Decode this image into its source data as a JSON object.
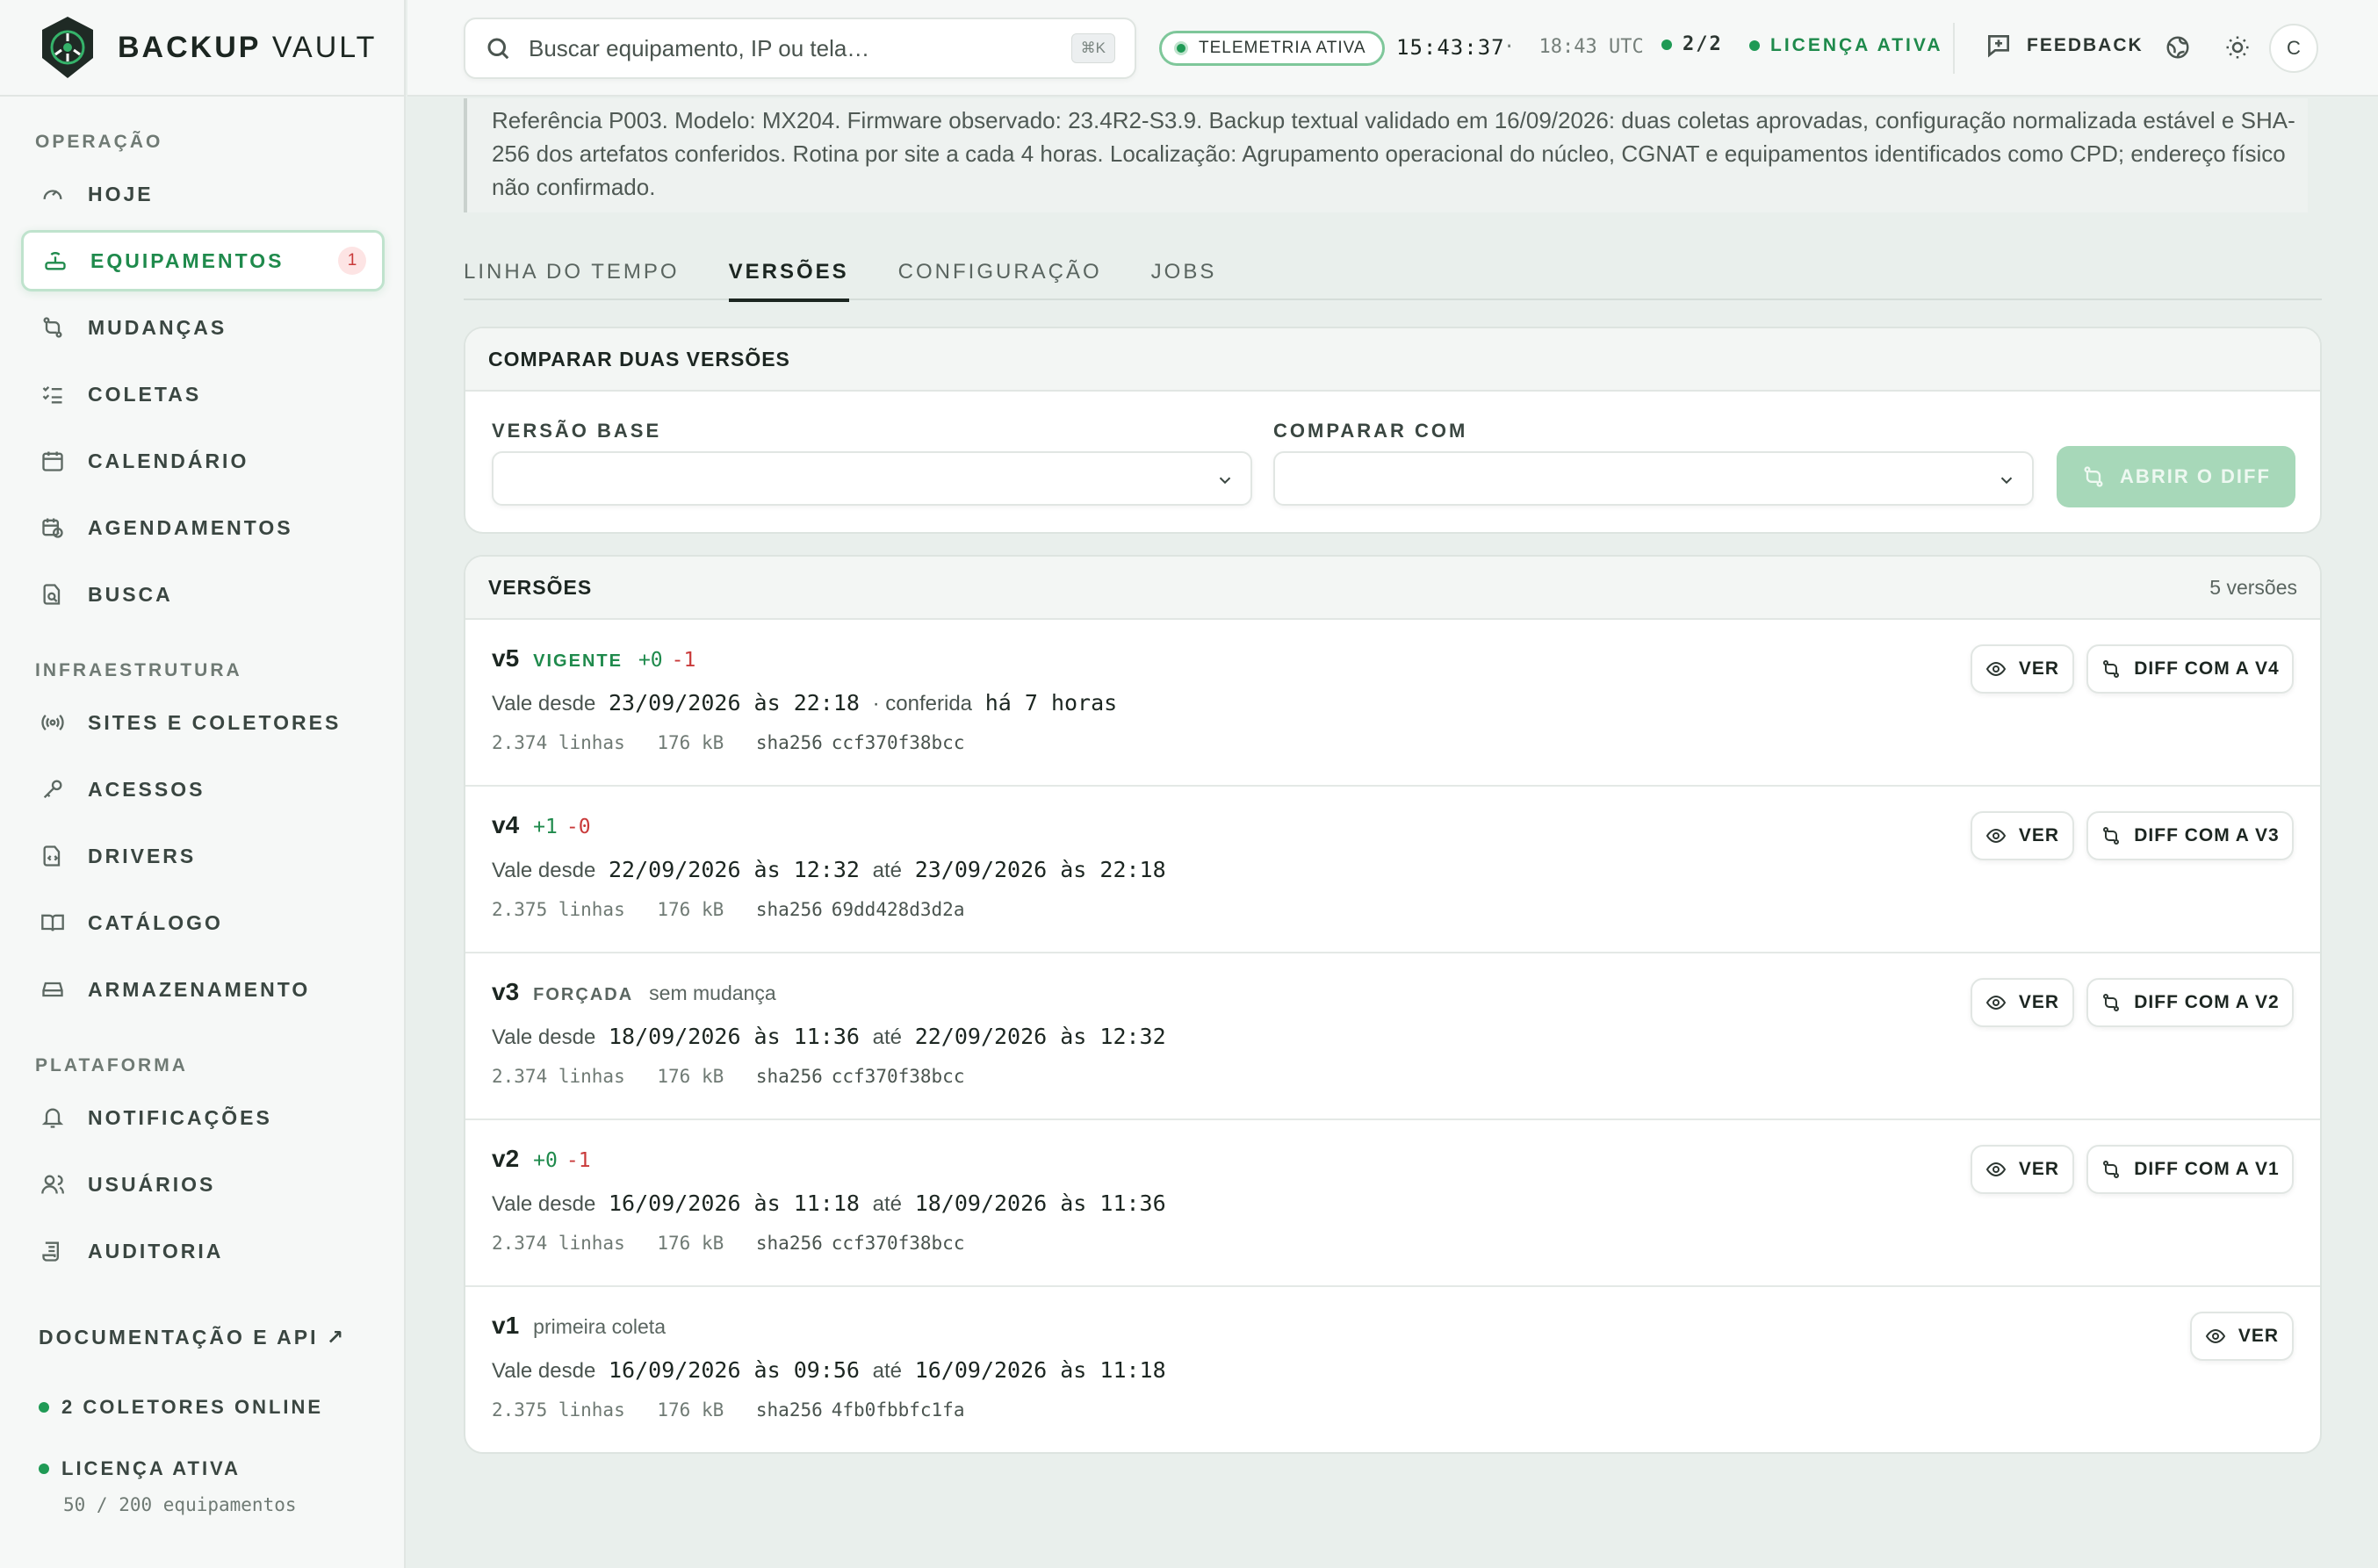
{
  "app": {
    "brand_bold": "BACKUP",
    "brand_light": "VAULT"
  },
  "sidebar": {
    "sections": [
      {
        "title": "OPERAÇÃO"
      },
      {
        "title": "INFRAESTRUTURA"
      },
      {
        "title": "PLATAFORMA"
      }
    ],
    "items": [
      {
        "label": "HOJE",
        "icon": "gauge-icon"
      },
      {
        "label": "EQUIPAMENTOS",
        "icon": "router-icon",
        "badge": "1",
        "active": true
      },
      {
        "label": "MUDANÇAS",
        "icon": "git-compare-icon"
      },
      {
        "label": "COLETAS",
        "icon": "list-checks-icon"
      },
      {
        "label": "CALENDÁRIO",
        "icon": "calendar-icon"
      },
      {
        "label": "AGENDAMENTOS",
        "icon": "calendar-clock-icon"
      },
      {
        "label": "BUSCA",
        "icon": "file-search-icon"
      },
      {
        "label": "SITES E COLETORES",
        "icon": "radio-icon"
      },
      {
        "label": "ACESSOS",
        "icon": "key-icon"
      },
      {
        "label": "DRIVERS",
        "icon": "file-code-icon"
      },
      {
        "label": "CATÁLOGO",
        "icon": "book-icon"
      },
      {
        "label": "ARMAZENAMENTO",
        "icon": "hard-drive-icon"
      },
      {
        "label": "NOTIFICAÇÕES",
        "icon": "bell-icon"
      },
      {
        "label": "USUÁRIOS",
        "icon": "users-icon"
      },
      {
        "label": "AUDITORIA",
        "icon": "scroll-icon"
      }
    ],
    "doc_link": "DOCUMENTAÇÃO E API ↗",
    "collectors_status": "2 COLETORES ONLINE",
    "license_status": "LICENÇA ATIVA",
    "license_usage": "50 / 200 equipamentos"
  },
  "topbar": {
    "search_placeholder": "Buscar equipamento, IP ou tela…",
    "search_shortcut": "⌘K",
    "telemetry": "TELEMETRIA ATIVA",
    "clock_local": "15:43:37",
    "clock_sep": "·",
    "clock_utc": "18:43 UTC",
    "collectors": "2/2",
    "license": "LICENÇA ATIVA",
    "feedback": "FEEDBACK",
    "avatar_initial": "C"
  },
  "device": {
    "description": "Referência P003. Modelo: MX204. Firmware observado: 23.4R2-S3.9. Backup textual validado em 16/09/2026: duas coletas aprovadas, configuração normalizada estável e SHA-256 dos artefatos conferidos. Rotina por site a cada 4 horas. Localização: Agrupamento operacional do núcleo, CGNAT e equipamentos identificados como CPD; endereço físico não confirmado."
  },
  "tabs": [
    {
      "label": "LINHA DO TEMPO"
    },
    {
      "label": "VERSÕES",
      "active": true
    },
    {
      "label": "CONFIGURAÇÃO"
    },
    {
      "label": "JOBS"
    }
  ],
  "compare": {
    "title": "COMPARAR DUAS VERSÕES",
    "base_label": "VERSÃO BASE",
    "base_value": "",
    "target_label": "COMPARAR COM",
    "target_value": "",
    "open_diff": "ABRIR O DIFF"
  },
  "versions": {
    "title": "VERSÕES",
    "count": "5 versões",
    "view_label": "VER",
    "rows": [
      {
        "name": "v5",
        "tag": "VIGENTE",
        "tag_color": "#1f8a4c",
        "plus": "+0",
        "minus": "-1",
        "note": "",
        "prefix": "Vale desde",
        "from": "23/09/2026 às 22:18",
        "mid": "· conferida",
        "to": "há 7 horas",
        "lines": "2.374 linhas",
        "size": "176 kB",
        "sha_label": "sha256",
        "sha": "ccf370f38bcc",
        "diff": "DIFF COM A V4"
      },
      {
        "name": "v4",
        "tag": "",
        "tag_color": "",
        "plus": "+1",
        "minus": "-0",
        "note": "",
        "prefix": "Vale desde",
        "from": "22/09/2026 às 12:32",
        "mid": "até",
        "to": "23/09/2026 às 22:18",
        "lines": "2.375 linhas",
        "size": "176 kB",
        "sha_label": "sha256",
        "sha": "69dd428d3d2a",
        "diff": "DIFF COM A V3"
      },
      {
        "name": "v3",
        "tag": "FORÇADA",
        "tag_color": "#5a6560",
        "plus": "",
        "minus": "",
        "note": "sem mudança",
        "prefix": "Vale desde",
        "from": "18/09/2026 às 11:36",
        "mid": "até",
        "to": "22/09/2026 às 12:32",
        "lines": "2.374 linhas",
        "size": "176 kB",
        "sha_label": "sha256",
        "sha": "ccf370f38bcc",
        "diff": "DIFF COM A V2"
      },
      {
        "name": "v2",
        "tag": "",
        "tag_color": "",
        "plus": "+0",
        "minus": "-1",
        "note": "",
        "prefix": "Vale desde",
        "from": "16/09/2026 às 11:18",
        "mid": "até",
        "to": "18/09/2026 às 11:36",
        "lines": "2.374 linhas",
        "size": "176 kB",
        "sha_label": "sha256",
        "sha": "ccf370f38bcc",
        "diff": "DIFF COM A V1"
      },
      {
        "name": "v1",
        "tag": "",
        "tag_color": "",
        "plus": "",
        "minus": "",
        "note": "primeira coleta",
        "prefix": "Vale desde",
        "from": "16/09/2026 às 09:56",
        "mid": "até",
        "to": "16/09/2026 às 11:18",
        "lines": "2.375 linhas",
        "size": "176 kB",
        "sha_label": "sha256",
        "sha": "4fb0fbbfc1fa",
        "diff": ""
      }
    ]
  }
}
